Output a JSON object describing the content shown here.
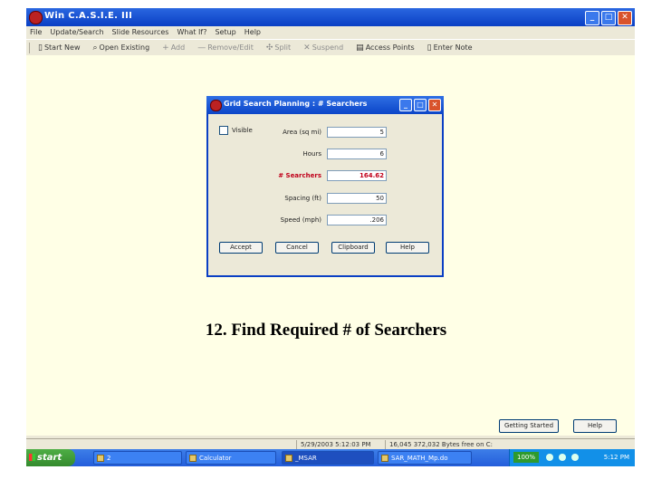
{
  "window": {
    "title": "Win C.A.S.I.E. III"
  },
  "menu": [
    "File",
    "Update/Search",
    "Slide Resources",
    "What If?",
    "Setup",
    "Help"
  ],
  "toolbar": [
    {
      "label": "Start New",
      "icon": "new-file-icon",
      "enabled": true
    },
    {
      "label": "Open Existing",
      "icon": "open-folder-icon",
      "enabled": true
    },
    {
      "label": "Add",
      "icon": "plus-icon",
      "enabled": false
    },
    {
      "label": "Remove/Edit",
      "icon": "minus-icon",
      "enabled": false
    },
    {
      "label": "Split",
      "icon": "split-icon",
      "enabled": false
    },
    {
      "label": "Suspend",
      "icon": "x-icon",
      "enabled": false
    },
    {
      "label": "Access Points",
      "icon": "printer-icon",
      "enabled": true
    },
    {
      "label": "Enter Note",
      "icon": "note-icon",
      "enabled": true
    }
  ],
  "dialog": {
    "title": "Grid Search Planning : # Searchers",
    "checkbox_label": "Visible",
    "fields": [
      {
        "label": "Area (sq mi)",
        "value": "5",
        "highlight": false
      },
      {
        "label": "Hours",
        "value": "6",
        "highlight": false
      },
      {
        "label": "# Searchers",
        "value": "164.62",
        "highlight": true
      },
      {
        "label": "Spacing (ft)",
        "value": "50",
        "highlight": false
      },
      {
        "label": "Speed (mph)",
        "value": ".206",
        "highlight": false
      }
    ],
    "buttons": [
      "Accept",
      "Cancel",
      "Clipboard",
      "Help"
    ]
  },
  "caption": "12. Find Required # of Searchers",
  "lower_buttons": {
    "getting_started": "Getting Started",
    "help": "Help"
  },
  "status": {
    "datetime": "5/29/2003 5:12:03 PM",
    "disk": "16,045 372,032 Bytes free on C:"
  },
  "taskbar": {
    "start": "start",
    "tasks": [
      "2",
      "Calculator",
      "_MSAR",
      "SAR_MATH_Mp.do"
    ],
    "zoom": "100%",
    "clock": "5:12 PM"
  },
  "colors": {
    "titlebar": "#0a3fc4",
    "highlight_text": "#c0001a",
    "workspace": "#ffffe6",
    "start": "#348a2d"
  }
}
